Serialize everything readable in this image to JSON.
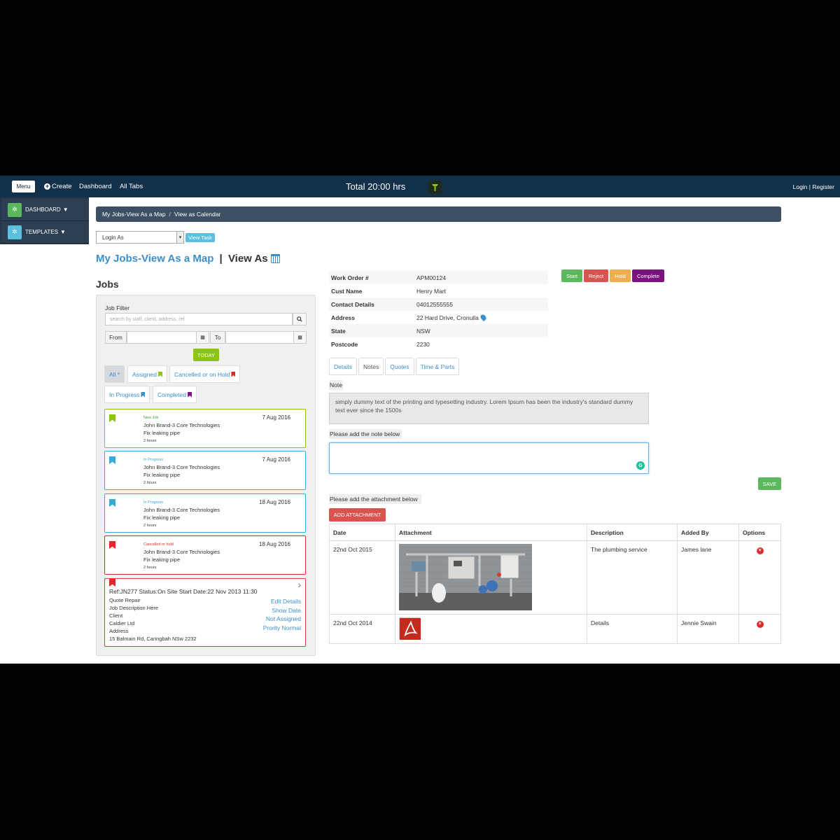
{
  "topbar": {
    "menu_label": "Menu",
    "create_label": "Create",
    "dashboard_label": "Dashboard",
    "alltabs_label": "All Tabs",
    "total_label": "Total 20:00 hrs",
    "login_label": "Login | Register"
  },
  "sidebar": {
    "items": [
      {
        "label": "DASHBOARD",
        "icon": "gear-icon",
        "color": "#5cb85c"
      },
      {
        "label": "TEMPLATES",
        "icon": "gear-icon",
        "color": "#5bc0de"
      }
    ]
  },
  "breadcrumb": {
    "item1": "My Jobs-View As a Map",
    "separator": "/",
    "item2": "View as Calendar"
  },
  "login_as": {
    "selected": "Login As",
    "view_task": "View Task"
  },
  "page_title": {
    "link": "My Jobs-View As a Map",
    "separator": " | ",
    "rest": "View As"
  },
  "jobs": {
    "heading": "Jobs",
    "filter_label": "Job Filter",
    "search_placeholder": "search by staff, client, address, ref",
    "from_label": "From",
    "to_label": "To",
    "today_label": "TODAY",
    "pills": [
      {
        "label": "All *",
        "color": ""
      },
      {
        "label": "Assigned",
        "color": "#8cc414"
      },
      {
        "label": "Cancelled or on Hold",
        "color": "#e02a2a"
      },
      {
        "label": "In Progress",
        "color": "#3a8fc9"
      },
      {
        "label": "Completed",
        "color": "#7b1280"
      }
    ],
    "cards": [
      {
        "status": "New Job",
        "date": "7 Aug 2016",
        "client": "John Brand-3 Core Technologies",
        "task": "Fix leaking pipe",
        "hours": "2 hours",
        "color": "#8cc414",
        "status_color": "#3aa33a"
      },
      {
        "status": "In Progress",
        "date": "7 Aug 2016",
        "client": "John Brand-3 Core Technologies",
        "task": "Fix leaking pipe",
        "hours": "2 hours",
        "color": "#39a9d6",
        "status_color": "#39a9d6"
      },
      {
        "status": "In Progress",
        "date": "18 Aug 2016",
        "client": "John Brand-3 Core Technologies",
        "task": "Fix leaking pipe",
        "hours": "2 hours",
        "color": "#39a9d6",
        "status_color": "#39a9d6"
      },
      {
        "status": "Cancelled or hold",
        "date": "18 Aug 2016",
        "client": "John Brand-3 Core Technologies",
        "task": "Fix leaking pipe",
        "hours": "2 hours",
        "color": "#e02a2a",
        "status_color": "#e02a2a"
      }
    ],
    "detail": {
      "ref_line": "Ref:JN277 Status:On Site Start Date:22 Nov 2013 11:30",
      "type": "Quote Repair",
      "description": "Job Description Here",
      "client_label": "Client",
      "client_name": "Caldier Ltd",
      "address_label": "Address",
      "address": "15 Balmain Rd, Caringbah NSw 2232",
      "edit_details": "Edit Details",
      "show_date": "Show Date",
      "assigned": "Not Assigned",
      "priority": "Prority Normal"
    }
  },
  "work_order": {
    "rows": [
      {
        "key": "Work Order #",
        "value": "APM00124"
      },
      {
        "key": "Cust Name",
        "value": "Henry Mart"
      },
      {
        "key": "Contact Details",
        "value": "04012555555"
      },
      {
        "key": "Address",
        "value": "22 Hard Drive, Cronulla"
      },
      {
        "key": "State",
        "value": "NSW"
      },
      {
        "key": "Postcode",
        "value": "2230"
      }
    ],
    "actions": [
      {
        "label": "Start",
        "color": "#5cb85c"
      },
      {
        "label": "Reject",
        "color": "#d9534f"
      },
      {
        "label": "Hold",
        "color": "#f0ad4e"
      },
      {
        "label": "Complete",
        "color": "#7b1280"
      }
    ]
  },
  "tabs": [
    {
      "label": "Details"
    },
    {
      "label": "Notes"
    },
    {
      "label": "Quotes"
    },
    {
      "label": "Time & Parts"
    }
  ],
  "notes": {
    "note_label": "Note",
    "note_text": "simply dummy text of the printing and typesetting industry. Lorem Ipsum has been the industry's standard dummy text ever since the 1500s",
    "add_note_label": "Please add the note below",
    "save_label": "SAVE",
    "add_attachment_label": "Please add the attachment below",
    "add_attachment_button": "ADD ATTACHMENT"
  },
  "attachments": {
    "headers": [
      "Date",
      "Attachment",
      "Description",
      "Added By",
      "Options"
    ],
    "rows": [
      {
        "date": "22nd Oct 2015",
        "attachment": "plumbing-image",
        "description": "The plumbing service",
        "added_by": "James larie"
      },
      {
        "date": "22nd Oct 2014",
        "attachment": "pdf-icon",
        "description": "Details",
        "added_by": "Jennie Swain"
      }
    ]
  }
}
